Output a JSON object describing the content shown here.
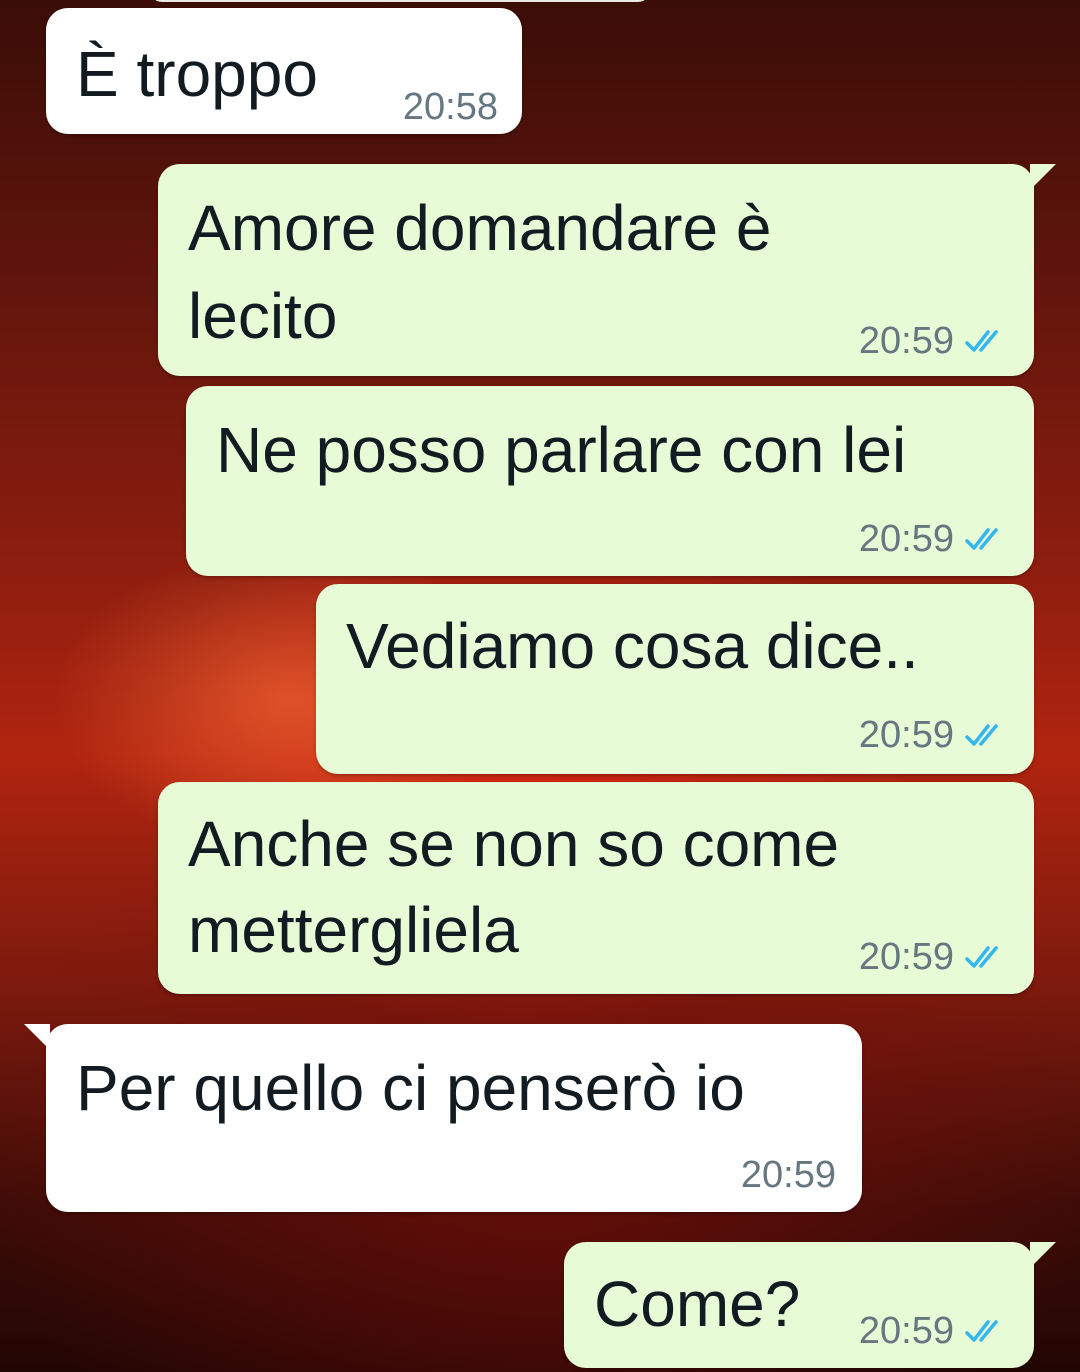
{
  "colors": {
    "incoming_bubble": "#ffffff",
    "outgoing_bubble": "#e7fbd6",
    "text": "#111b21",
    "timestamp": "#667781",
    "read_ticks": "#34b7f1"
  },
  "messages": [
    {
      "direction": "incoming",
      "text": "È troppo",
      "time": "20:58"
    },
    {
      "direction": "outgoing",
      "line1": "Amore domandare è",
      "line2": "lecito",
      "time": "20:59",
      "status_icon": "double-check-read-icon"
    },
    {
      "direction": "outgoing",
      "text": "Ne posso parlare con lei",
      "time": "20:59",
      "status_icon": "double-check-read-icon"
    },
    {
      "direction": "outgoing",
      "text": "Vediamo cosa dice..",
      "time": "20:59",
      "status_icon": "double-check-read-icon"
    },
    {
      "direction": "outgoing",
      "line1": "Anche se non so come",
      "line2": "mettergliela",
      "time": "20:59",
      "status_icon": "double-check-read-icon"
    },
    {
      "direction": "incoming",
      "text": "Per quello ci penserò io",
      "time": "20:59"
    },
    {
      "direction": "outgoing",
      "text": "Come?",
      "time": "20:59",
      "status_icon": "double-check-read-icon"
    }
  ]
}
